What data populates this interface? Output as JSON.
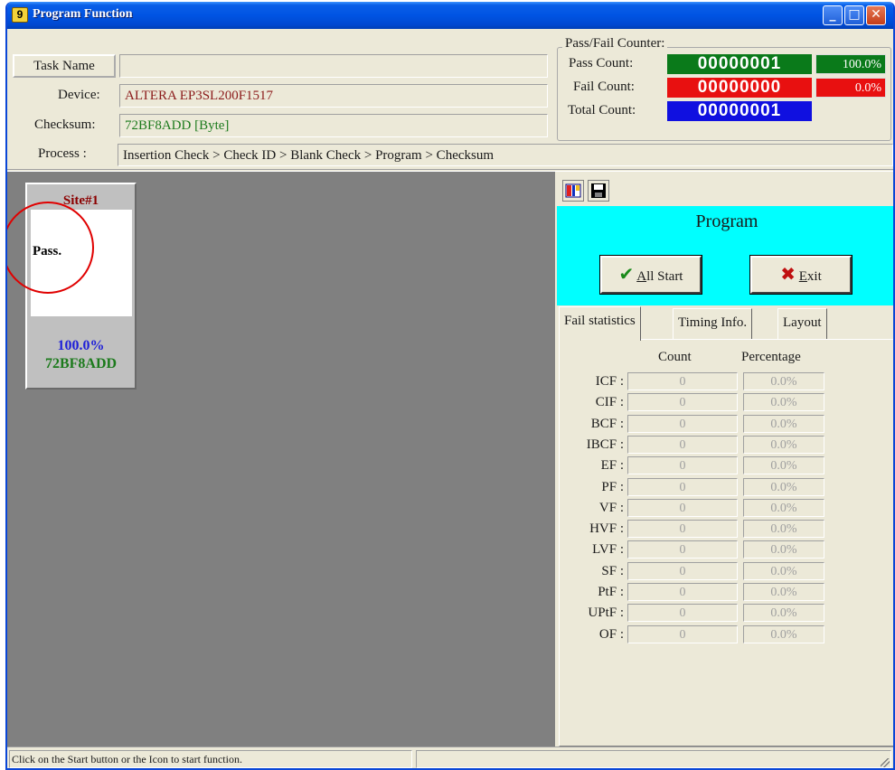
{
  "window": {
    "title": "Program Function",
    "icon_glyph": "9"
  },
  "header": {
    "task_name_button": "Task Name",
    "task_name_value": "",
    "device_label": "Device:",
    "device_value": "ALTERA EP3SL200F1517",
    "checksum_label": "Checksum:",
    "checksum_value": "72BF8ADD [Byte]",
    "process_label": "Process :",
    "process_value": "Insertion Check > Check ID > Blank Check > Program > Checksum"
  },
  "counter": {
    "group_title": "Pass/Fail Counter:",
    "pass_label": "Pass Count:",
    "pass_value": "00000001",
    "pass_pct": "100.0%",
    "fail_label": "Fail Count:",
    "fail_value": "00000000",
    "fail_pct": "0.0%",
    "total_label": "Total Count:",
    "total_value": "00000001",
    "colors": {
      "pass": "#0a7a1a",
      "fail": "#e81010",
      "total": "#1010e0"
    }
  },
  "site": {
    "title": "Site#1",
    "status": "Pass.",
    "percentage": "100.0%",
    "checksum": "72BF8ADD"
  },
  "panel": {
    "operation": "Program",
    "all_start_prefix": "A",
    "all_start_rest": "ll Start",
    "exit_prefix": "E",
    "exit_rest": "xit",
    "accent_color": "#00ffff"
  },
  "tabs": [
    {
      "label": "Fail statistics",
      "active": true
    },
    {
      "label": "Timing Info.",
      "active": false
    },
    {
      "label": "Layout",
      "active": false
    }
  ],
  "fail_stats": {
    "count_header": "Count",
    "percentage_header": "Percentage",
    "rows": [
      {
        "label": "ICF :",
        "count": "0",
        "pct": "0.0%"
      },
      {
        "label": "CIF :",
        "count": "0",
        "pct": "0.0%"
      },
      {
        "label": "BCF :",
        "count": "0",
        "pct": "0.0%"
      },
      {
        "label": "IBCF :",
        "count": "0",
        "pct": "0.0%"
      },
      {
        "label": "EF :",
        "count": "0",
        "pct": "0.0%"
      },
      {
        "label": "PF :",
        "count": "0",
        "pct": "0.0%"
      },
      {
        "label": "VF :",
        "count": "0",
        "pct": "0.0%"
      },
      {
        "label": "HVF :",
        "count": "0",
        "pct": "0.0%"
      },
      {
        "label": "LVF :",
        "count": "0",
        "pct": "0.0%"
      },
      {
        "label": "SF :",
        "count": "0",
        "pct": "0.0%"
      },
      {
        "label": "PtF :",
        "count": "0",
        "pct": "0.0%"
      },
      {
        "label": "UPtF :",
        "count": "0",
        "pct": "0.0%"
      },
      {
        "label": "OF :",
        "count": "0",
        "pct": "0.0%"
      }
    ]
  },
  "statusbar": {
    "message": "Click on the Start button or the Icon to start function.",
    "secondary": ""
  }
}
